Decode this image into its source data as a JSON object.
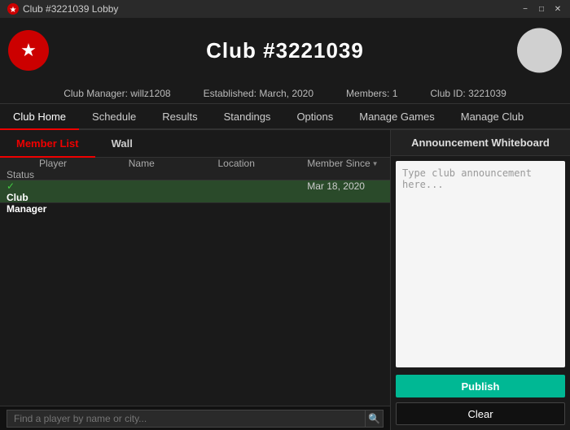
{
  "titleBar": {
    "title": "Club #3221039 Lobby",
    "controls": {
      "minimize": "−",
      "maximize": "□",
      "close": "✕"
    }
  },
  "header": {
    "title": "Club #3221039",
    "logoStar": "★"
  },
  "infoBar": {
    "manager": "Club Manager: willz1208",
    "established": "Established: March, 2020",
    "members": "Members: 1",
    "clubId": "Club ID: 3221039"
  },
  "navBar": {
    "items": [
      {
        "label": "Club Home",
        "active": true
      },
      {
        "label": "Schedule",
        "active": false
      },
      {
        "label": "Results",
        "active": false
      },
      {
        "label": "Standings",
        "active": false
      },
      {
        "label": "Options",
        "active": false
      },
      {
        "label": "Manage Games",
        "active": false
      },
      {
        "label": "Manage Club",
        "active": false
      }
    ]
  },
  "subTabs": [
    {
      "label": "Member List",
      "active": true
    },
    {
      "label": "Wall",
      "active": false
    }
  ],
  "table": {
    "headers": [
      {
        "label": ""
      },
      {
        "label": "Player"
      },
      {
        "label": "Name"
      },
      {
        "label": "Location"
      },
      {
        "label": "Member Since",
        "sortable": true
      },
      {
        "label": "Status"
      }
    ],
    "rows": [
      {
        "checkmark": "✓",
        "player": "",
        "name": "",
        "location": "",
        "memberSince": "Mar 18, 2020",
        "status": "Club Manager",
        "highlighted": true
      }
    ]
  },
  "search": {
    "placeholder": "Find a player by name or city...",
    "iconSymbol": "🔍"
  },
  "whiteboard": {
    "title": "Announcement Whiteboard",
    "placeholder": "Type club announcement here...",
    "publishLabel": "Publish",
    "clearLabel": "Clear"
  }
}
